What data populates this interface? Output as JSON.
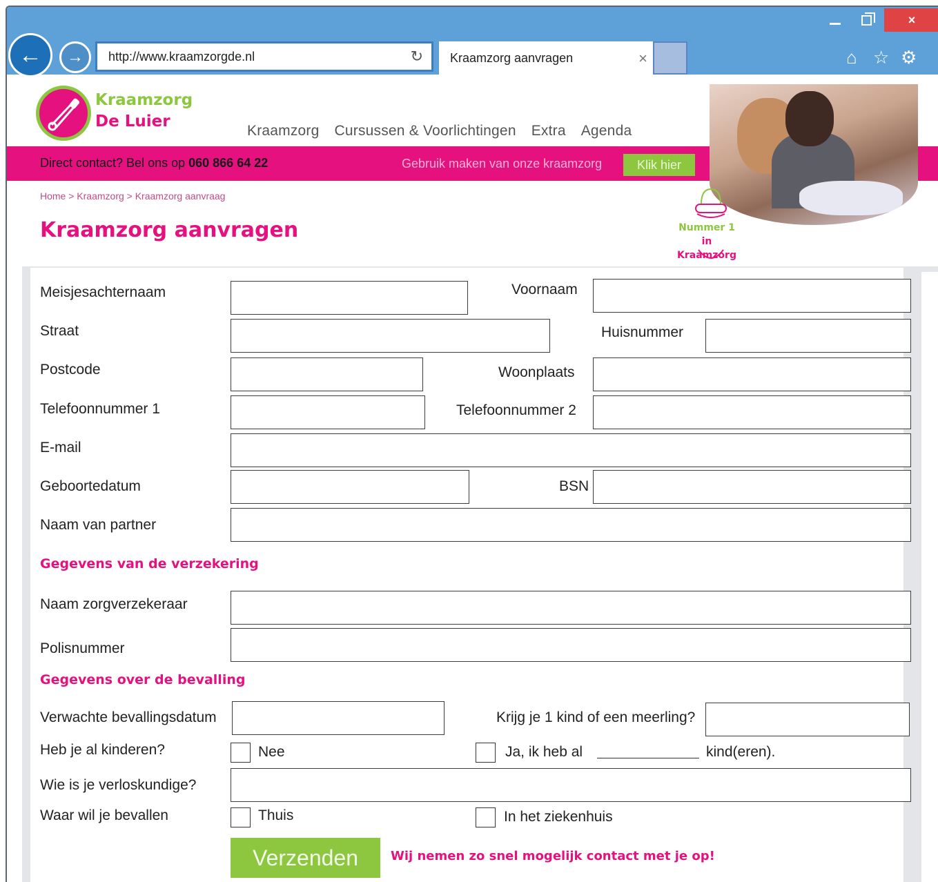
{
  "browser": {
    "url": "http://www.kraamzorgde.nl",
    "tab_title": "Kraamzorg aanvragen",
    "window_controls": {
      "minimize": "–",
      "close": "×"
    },
    "back_icon": "arrow-left-icon",
    "forward_icon": "arrow-right-icon",
    "colors": {
      "chrome": "#5ea0d8",
      "close": "#e04343"
    }
  },
  "site": {
    "logo_line1": "Kraamzorg",
    "logo_line2": "De Luier",
    "nav": [
      "Kraamzorg",
      "Cursussen & Voorlichtingen",
      "Extra",
      "Agenda"
    ],
    "contact_prefix": "Direct contact? Bel ons op ",
    "contact_phone": "060 866 64 22",
    "promo_text": "Gebruik maken van onze kraamzorg",
    "promo_button": "Klik hier",
    "badge_line1": "Nummer 1",
    "badge_line2": "in Kraamzorg",
    "breadcrumb": "Home > Kraamzorg > Kraamzorg aanvraag",
    "page_title": "Kraamzorg aanvragen",
    "colors": {
      "pink": "#e4117f",
      "green": "#8dc63f"
    }
  },
  "form": {
    "labels": {
      "meisjesachternaam": "Meisjesachternaam",
      "voornaam": "Voornaam",
      "straat": "Straat",
      "huisnummer": "Huisnummer",
      "postcode": "Postcode",
      "woonplaats": "Woonplaats",
      "telefoon1": "Telefoonnummer 1",
      "telefoon2": "Telefoonnummer 2",
      "email": "E-mail",
      "geboortedatum": "Geboortedatum",
      "bsn": "BSN",
      "partner": "Naam van partner",
      "zorgverzekeraar": "Naam zorgverzekeraar",
      "polisnummer": "Polisnummer",
      "bevallingsdatum": "Verwachte bevallingsdatum",
      "meerling": "Krijg je 1 kind of een meerling?",
      "kinderen": "Heb je al kinderen?",
      "verloskundige": "Wie is je verloskundige?",
      "bevallen": "Waar wil je bevallen"
    },
    "sections": {
      "verzekering": "Gegevens van de verzekering",
      "bevalling": "Gegevens over de bevalling"
    },
    "options": {
      "nee": "Nee",
      "ja_prefix": "Ja, ik heb al",
      "ja_suffix": "kind(eren).",
      "thuis": "Thuis",
      "ziekenhuis": "In het ziekenhuis"
    },
    "submit": "Verzenden",
    "note": "Wij nemen zo snel mogelijk contact met je op!"
  }
}
